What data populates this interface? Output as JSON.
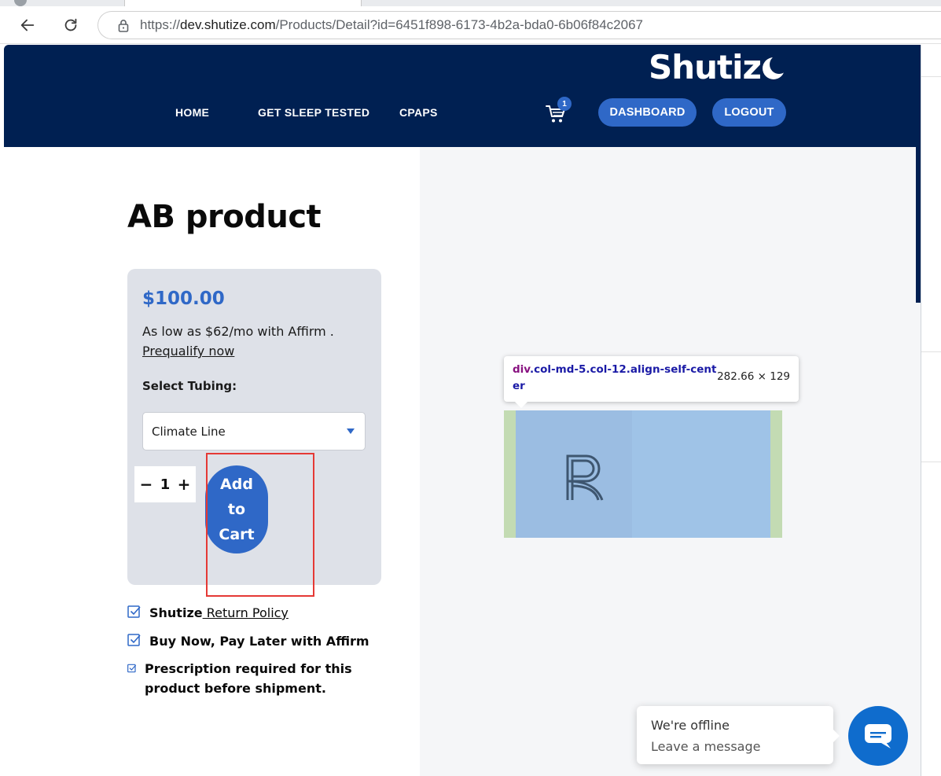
{
  "browser": {
    "url_prefix": "https://",
    "url_host": "dev.shutize.com",
    "url_path": "/Products/Detail?id=6451f898-6173-4b2a-bda0-6b06f84c2067"
  },
  "header": {
    "brand": "Shutiz",
    "nav": {
      "home": "HOME",
      "sleep": "GET SLEEP TESTED",
      "cpaps": "CPAPS"
    },
    "cart_count": "1",
    "dashboard_label": "DASHBOARD",
    "logout_label": "LOGOUT"
  },
  "product": {
    "title": "AB product",
    "price": "$100.00",
    "affirm_text": "As low as $62/mo with Affirm .",
    "prequalify_label": "Prequalify now",
    "select_label": "Select Tubing:",
    "select_value": "Climate Line",
    "quantity": "1",
    "qty_minus": "−",
    "qty_plus": "+",
    "add_to_cart": {
      "line1": "Add",
      "line2": "to",
      "line3": "Cart"
    }
  },
  "features": {
    "return_bold": "Shutize",
    "return_link": " Return Policy",
    "affirm": "Buy Now, Pay Later with Affirm",
    "prescription_line1": "Prescription required for this",
    "prescription_line2": "product before shipment."
  },
  "inspector": {
    "tag": "div",
    "selector_rest": ".col-md-5.col-12.align-self-center",
    "size": "282.66 × 129"
  },
  "chat": {
    "status": "We're offline",
    "sub": "Leave a message"
  },
  "colors": {
    "header_bg": "#002052",
    "accent": "#2f68c7",
    "card_bg": "#dee1e8",
    "highlight": "#e53935"
  },
  "icons": {
    "back": "arrow-left-icon",
    "refresh": "refresh-icon",
    "lock": "lock-icon",
    "cart": "cart-icon",
    "check": "checkbox-checked-icon",
    "chat": "chat-icon"
  }
}
